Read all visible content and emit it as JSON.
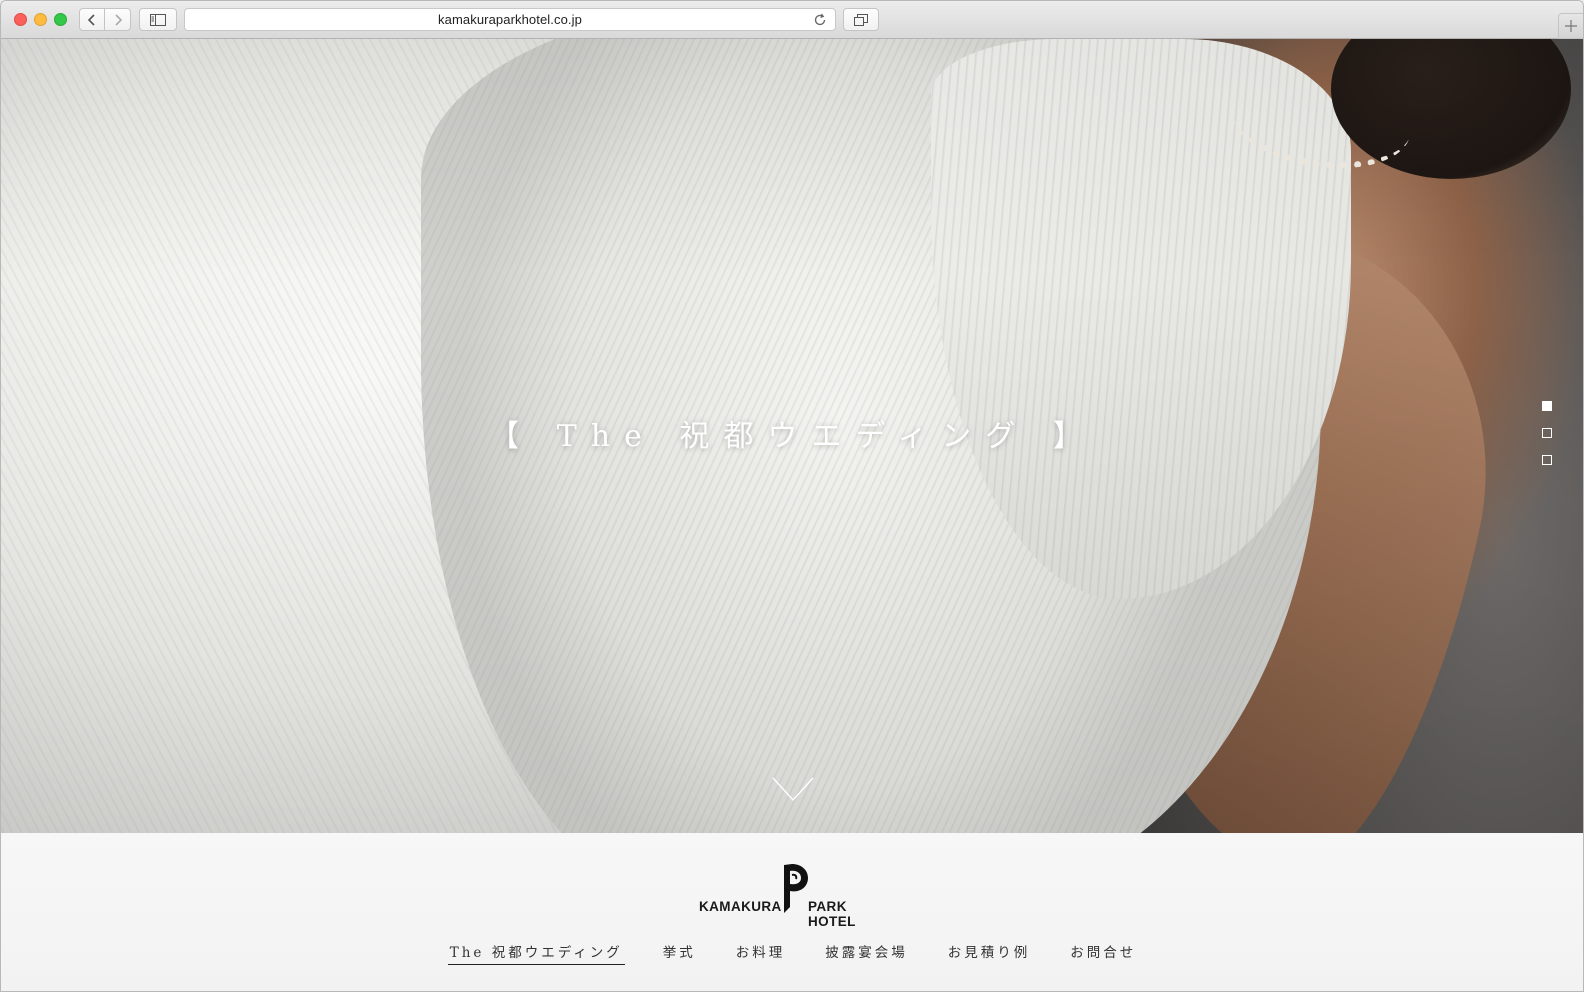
{
  "browser": {
    "url": "kamakuraparkhotel.co.jp"
  },
  "hero": {
    "title": "【 The 祝都ウエディング 】",
    "pager_count": 3,
    "pager_active": 1
  },
  "logo": {
    "left_text": "KAMAKURA",
    "right_text": "PARK HOTEL"
  },
  "menu": {
    "items": [
      {
        "label": "The 祝都ウエディング",
        "active": true
      },
      {
        "label": "挙式",
        "active": false
      },
      {
        "label": "お料理",
        "active": false
      },
      {
        "label": "披露宴会場",
        "active": false
      },
      {
        "label": "お見積り例",
        "active": false
      },
      {
        "label": "お問合せ",
        "active": false
      }
    ]
  },
  "colors": {
    "menu_text": "#333333",
    "hero_text": "#ffffff"
  }
}
